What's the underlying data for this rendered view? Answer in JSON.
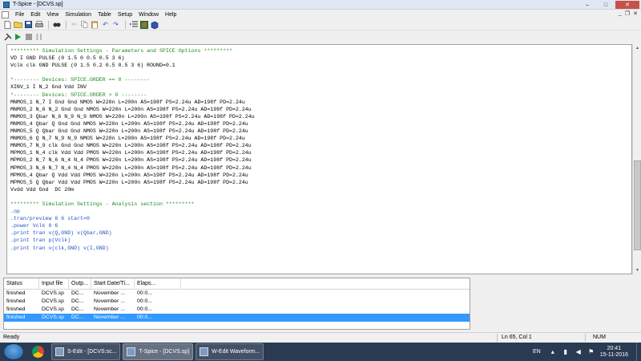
{
  "window": {
    "title": "T-Spice - [DCVS.sp]"
  },
  "window_controls": {
    "minimize": "–",
    "maximize": "□",
    "close": "✕"
  },
  "mdi_controls": {
    "minimize": "_",
    "restore": "❐",
    "close": "✕"
  },
  "menu": [
    "File",
    "Edit",
    "View",
    "Simulation",
    "Table",
    "Setup",
    "Window",
    "Help"
  ],
  "code_lines": [
    {
      "text": "********* Simulation Settings - Parameters and SPICE Options *********",
      "color": "#1c8a1c"
    },
    {
      "text": "VD I GND PULSE (0 1.5 0 0.5 0.5 3 6)",
      "color": "#000000"
    },
    {
      "text": "Vclk clk GND PULSE (0 1.5 0.2 0.5 0.5 3 6) ROUND=0.1",
      "color": "#000000"
    },
    {
      "text": "",
      "color": "#000000"
    },
    {
      "text": "*-------- Devices: SPICE.ORDER == 0 --------",
      "color": "#1c8a1c"
    },
    {
      "text": "XINV_1 I N_2 Gnd Vdd INV",
      "color": "#000000"
    },
    {
      "text": "*-------- Devices: SPICE.ORDER > 0 --------",
      "color": "#1c8a1c"
    },
    {
      "text": "MNMOS_1 N_7 I Gnd Gnd NMOS W=220n L=200n AS=198f PS=2.24u AD=198f PD=2.24u",
      "color": "#000000"
    },
    {
      "text": "MNMOS_2 N_6 N_2 Gnd Gnd NMOS W=220n L=200n AS=198f PS=2.24u AD=198f PD=2.24u",
      "color": "#000000"
    },
    {
      "text": "MNMOS_3 Qbar N_6 N_9 N_9 NMOS W=220n L=200n AS=198f PS=2.24u AD=198f PD=2.24u",
      "color": "#000000"
    },
    {
      "text": "MNMOS_4 Qbar Q Gnd Gnd NMOS W=220n L=200n AS=198f PS=2.24u AD=198f PD=2.24u",
      "color": "#000000"
    },
    {
      "text": "MNMOS_5 Q Qbar Gnd Gnd NMOS W=220n L=200n AS=198f PS=2.24u AD=198f PD=2.24u",
      "color": "#000000"
    },
    {
      "text": "MNMOS_6 Q N_7 N_9 N_9 NMOS W=220n L=200n AS=198f PS=2.24u AD=198f PD=2.24u",
      "color": "#000000"
    },
    {
      "text": "MNMOS_7 N_9 clk Gnd Gnd NMOS W=220n L=200n AS=198f PS=2.24u AD=198f PD=2.24u",
      "color": "#000000"
    },
    {
      "text": "MPMOS_1 N_4 clk Vdd Vdd PMOS W=220n L=200n AS=198f PS=2.24u AD=198f PD=2.24u",
      "color": "#000000"
    },
    {
      "text": "MPMOS_2 N_7 N_6 N_4 N_4 PMOS W=220n L=200n AS=198f PS=2.24u AD=198f PD=2.24u",
      "color": "#000000"
    },
    {
      "text": "MPMOS_3 N_6 N_7 N_4 N_4 PMOS W=220n L=200n AS=198f PS=2.24u AD=198f PD=2.24u",
      "color": "#000000"
    },
    {
      "text": "MPMOS_4 Qbar Q Vdd Vdd PMOS W=220n L=200n AS=198f PS=2.24u AD=198f PD=2.24u",
      "color": "#000000"
    },
    {
      "text": "MPMOS_5 Q Qbar Vdd Vdd PMOS W=220n L=200n AS=198f PS=2.24u AD=198f PD=2.24u",
      "color": "#000000"
    },
    {
      "text": "Vvdd Vdd Gnd  DC 20m",
      "color": "#000000"
    },
    {
      "text": "",
      "color": "#000000"
    },
    {
      "text": "********* Simulation Settings - Analysis section *********",
      "color": "#1c8a1c"
    },
    {
      "text": ".op",
      "color": "#2253c5"
    },
    {
      "text": ".tran/preview 6 6 start=0",
      "color": "#2253c5"
    },
    {
      "text": ".power Vclk 0 6",
      "color": "#2253c5"
    },
    {
      "text": ".print tran v(Q,GND) v(Qbar,GND)",
      "color": "#2253c5"
    },
    {
      "text": ".print tran p(Vclk)",
      "color": "#2253c5"
    },
    {
      "text": ".print tran v(clk,GND) v(I,GND)",
      "color": "#2253c5"
    }
  ],
  "sim_table": {
    "headers": [
      "Status",
      "Input file",
      "Outp...",
      "Start Date/Ti...",
      "Elaps..."
    ],
    "rows": [
      {
        "status": "finished",
        "input": "DCVS.sp",
        "output": "DC...",
        "start": "November ...",
        "elapsed": "00:0..."
      },
      {
        "status": "finished",
        "input": "DCVS.sp",
        "output": "DC...",
        "start": "November ...",
        "elapsed": "00:0..."
      },
      {
        "status": "finished",
        "input": "DCVS.sp",
        "output": "DC...",
        "start": "November ...",
        "elapsed": "00:0..."
      },
      {
        "status": "finished",
        "input": "DCVS.sp",
        "output": "DC...",
        "start": "November ...",
        "elapsed": "00:0...",
        "selected": true
      }
    ]
  },
  "statusbar": {
    "ready": "Ready",
    "position": "Ln 65, Col 1",
    "num": "NUM"
  },
  "taskbar": {
    "tasks": [
      {
        "label": "S-Edit - [DCVS:sc..."
      },
      {
        "label": "T-Spice - [DCVS.sp]",
        "active": true
      },
      {
        "label": "W-Edit Waveform..."
      }
    ],
    "lang": "EN",
    "time": "20:41",
    "date": "15-11-2016"
  },
  "colors": {
    "comment": "#1c8a1c",
    "command": "#2253c5",
    "selection": "#3399ff",
    "taskbar": "#2a3a52"
  }
}
